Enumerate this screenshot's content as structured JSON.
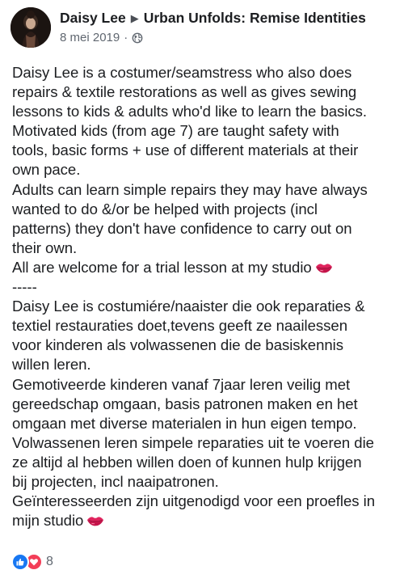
{
  "post": {
    "author": "Daisy Lee",
    "group": "Urban Unfolds: Remise Identities",
    "date": "8 mei 2019",
    "separator": "·",
    "privacy_icon": "globe-icon",
    "lines": [
      "Daisy Lee is a costumer/seamstress who also does",
      "repairs & textile restorations as well as gives sewing",
      "lessons to kids & adults who'd like to learn the basics.",
      "Motivated kids (from age 7) are taught safety with",
      "tools, basic forms + use of different materials at their",
      "own pace.",
      "Adults can learn simple repairs they may have always",
      "wanted to do &/or be helped with projects (incl",
      "patterns) they don't have confidence to carry out on",
      "their own.",
      "All are welcome for a trial lesson at my studio",
      "-----",
      "Daisy Lee is costumiére/naaister die ook reparaties &",
      "textiel restauraties doet,tevens geeft ze naailessen",
      "voor kinderen als volwassenen die de basiskennis",
      "willen leren.",
      "Gemotiveerde kinderen vanaf 7jaar leren veilig met",
      "gereedschap omgaan, basis patronen maken en het",
      "omgaan met diverse materialen in hun eigen tempo.",
      "Volwassenen leren simpele reparaties uit te voeren die",
      "ze altijd al hebben willen doen of kunnen hulp krijgen",
      "bij projecten, incl naaipatronen.",
      "Geïnteresseerden zijn uitgenodigd voor een proefles in",
      "mijn studio"
    ],
    "emoji_after_lines": [
      10,
      23
    ],
    "emoji_icon": "kiss-lips-icon"
  },
  "reactions": {
    "icons": [
      "like-icon",
      "love-icon"
    ],
    "count": "8",
    "colors": {
      "like": "#1877f2",
      "love": "#f33e58"
    }
  }
}
